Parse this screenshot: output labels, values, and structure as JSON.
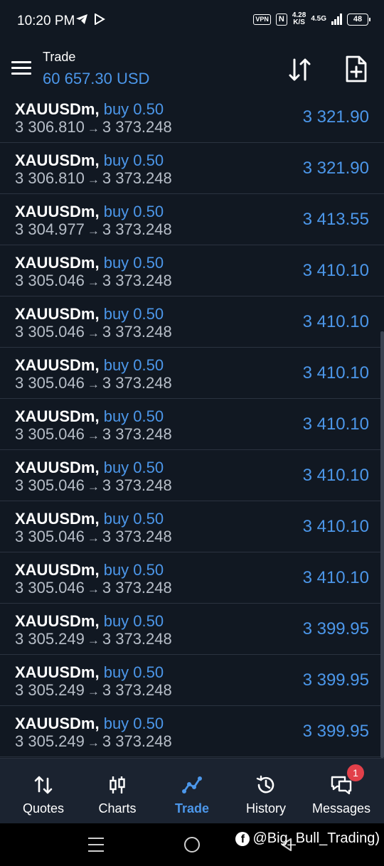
{
  "status_bar": {
    "time": "10:20 PM",
    "vpn": "VPN",
    "nfc": "N",
    "net_speed_value": "4.28",
    "net_speed_unit": "K/S",
    "network": "4.5G",
    "battery": "48"
  },
  "header": {
    "title": "Trade",
    "balance": "60 657.30 USD"
  },
  "colors": {
    "background": "#111822",
    "accent": "#4c97ea",
    "divider": "#2b3340",
    "nav_bg": "#1b2330",
    "badge": "#e2404a"
  },
  "trades": [
    {
      "symbol": "XAUUSDm,",
      "side": "buy 0.50",
      "open": "3 306.810",
      "arrow": "→",
      "current": "3 373.248",
      "price": "3 321.90"
    },
    {
      "symbol": "XAUUSDm,",
      "side": "buy 0.50",
      "open": "3 306.810",
      "arrow": "→",
      "current": "3 373.248",
      "price": "3 321.90"
    },
    {
      "symbol": "XAUUSDm,",
      "side": "buy 0.50",
      "open": "3 304.977",
      "arrow": "→",
      "current": "3 373.248",
      "price": "3 413.55"
    },
    {
      "symbol": "XAUUSDm,",
      "side": "buy 0.50",
      "open": "3 305.046",
      "arrow": "→",
      "current": "3 373.248",
      "price": "3 410.10"
    },
    {
      "symbol": "XAUUSDm,",
      "side": "buy 0.50",
      "open": "3 305.046",
      "arrow": "→",
      "current": "3 373.248",
      "price": "3 410.10"
    },
    {
      "symbol": "XAUUSDm,",
      "side": "buy 0.50",
      "open": "3 305.046",
      "arrow": "→",
      "current": "3 373.248",
      "price": "3 410.10"
    },
    {
      "symbol": "XAUUSDm,",
      "side": "buy 0.50",
      "open": "3 305.046",
      "arrow": "→",
      "current": "3 373.248",
      "price": "3 410.10"
    },
    {
      "symbol": "XAUUSDm,",
      "side": "buy 0.50",
      "open": "3 305.046",
      "arrow": "→",
      "current": "3 373.248",
      "price": "3 410.10"
    },
    {
      "symbol": "XAUUSDm,",
      "side": "buy 0.50",
      "open": "3 305.046",
      "arrow": "→",
      "current": "3 373.248",
      "price": "3 410.10"
    },
    {
      "symbol": "XAUUSDm,",
      "side": "buy 0.50",
      "open": "3 305.046",
      "arrow": "→",
      "current": "3 373.248",
      "price": "3 410.10"
    },
    {
      "symbol": "XAUUSDm,",
      "side": "buy 0.50",
      "open": "3 305.249",
      "arrow": "→",
      "current": "3 373.248",
      "price": "3 399.95"
    },
    {
      "symbol": "XAUUSDm,",
      "side": "buy 0.50",
      "open": "3 305.249",
      "arrow": "→",
      "current": "3 373.248",
      "price": "3 399.95"
    },
    {
      "symbol": "XAUUSDm,",
      "side": "buy 0.50",
      "open": "3 305.249",
      "arrow": "→",
      "current": "3 373.248",
      "price": "3 399.95"
    }
  ],
  "bottom_nav": {
    "items": [
      {
        "label": "Quotes",
        "icon": "quotes-icon"
      },
      {
        "label": "Charts",
        "icon": "charts-icon"
      },
      {
        "label": "Trade",
        "icon": "trade-icon",
        "active": true
      },
      {
        "label": "History",
        "icon": "history-icon"
      },
      {
        "label": "Messages",
        "icon": "messages-icon",
        "badge": "1"
      }
    ]
  },
  "watermark": {
    "text": "@Big_Bull_Trading)"
  }
}
